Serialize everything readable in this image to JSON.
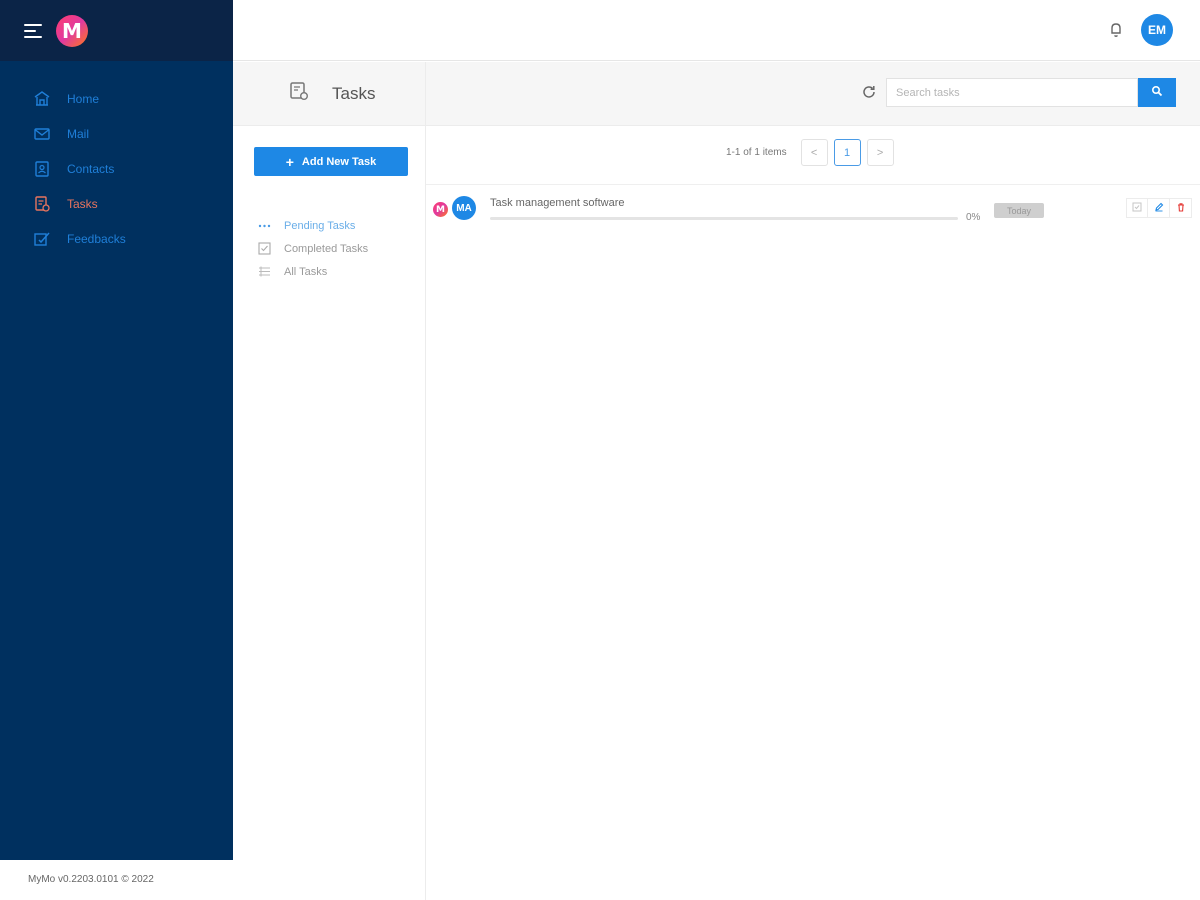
{
  "brand": {
    "logo_letter": "M",
    "footer": "MyMo v0.2203.0101 © 2022"
  },
  "sidebar": {
    "items": [
      {
        "label": "Home",
        "icon": "home-icon"
      },
      {
        "label": "Mail",
        "icon": "mail-icon"
      },
      {
        "label": "Contacts",
        "icon": "contacts-icon"
      },
      {
        "label": "Tasks",
        "icon": "tasks-icon",
        "active": true
      },
      {
        "label": "Feedbacks",
        "icon": "feedback-icon"
      }
    ]
  },
  "topbar": {
    "avatar_initials": "EM"
  },
  "tasks_panel": {
    "title": "Tasks",
    "add_button": "Add New Task",
    "filters": [
      {
        "label": "Pending Tasks",
        "active": true
      },
      {
        "label": "Completed Tasks"
      },
      {
        "label": "All Tasks"
      }
    ]
  },
  "search": {
    "placeholder": "Search tasks"
  },
  "pagination": {
    "summary": "1-1 of 1 items",
    "prev": "<",
    "current_page": "1",
    "next": ">"
  },
  "tasks": [
    {
      "source_logo": "M",
      "assignee_initials": "MA",
      "title": "Task management software",
      "progress": 0,
      "progress_label": "0%",
      "due": "Today"
    }
  ],
  "colors": {
    "sidebar_bg": "#00305f",
    "sidebar_top_bg": "#0b2447",
    "accent": "#1e88e5",
    "nav_link": "#1f7fd8",
    "nav_active": "#e8745e"
  }
}
